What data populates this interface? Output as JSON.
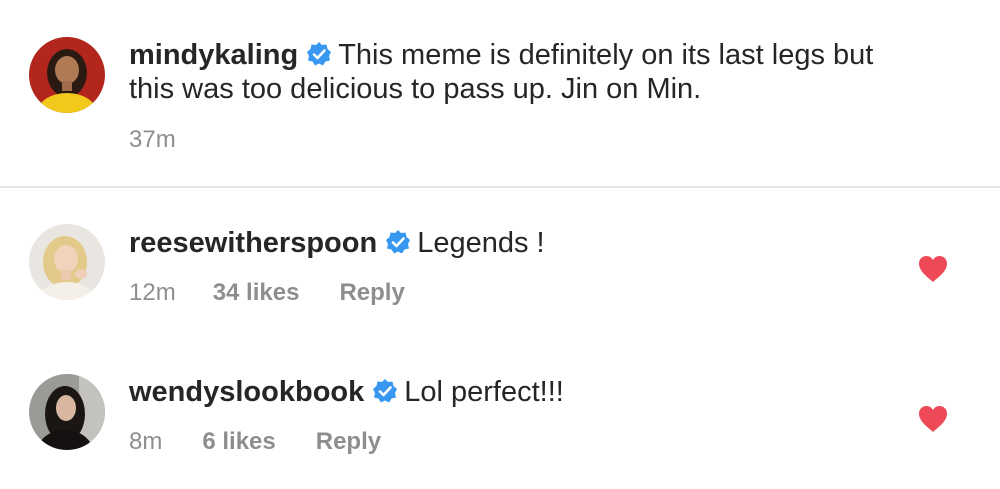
{
  "caption": {
    "username": "mindykaling",
    "text_line1": "This meme is definitely on its last legs but",
    "text_line2": "this was too delicious to pass up. Jin on Min.",
    "time": "37m",
    "avatar_icon": "avatar-woman-yellow-top",
    "verified_icon": "verified-badge-icon"
  },
  "comments": [
    {
      "username": "reesewitherspoon",
      "text": "Legends !",
      "time": "12m",
      "likes": "34 likes",
      "reply": "Reply",
      "avatar_icon": "avatar-blonde-woman",
      "like_icon": "heart-icon"
    },
    {
      "username": "wendyslookbook",
      "text": "Lol perfect!!!",
      "time": "8m",
      "likes": "6 likes",
      "reply": "Reply",
      "avatar_icon": "avatar-dark-haired-woman",
      "like_icon": "heart-icon"
    }
  ],
  "colors": {
    "verified": "#3897f0",
    "heart": "#ed4956",
    "meta_text": "#8e8e8e",
    "primary_text": "#262626"
  }
}
